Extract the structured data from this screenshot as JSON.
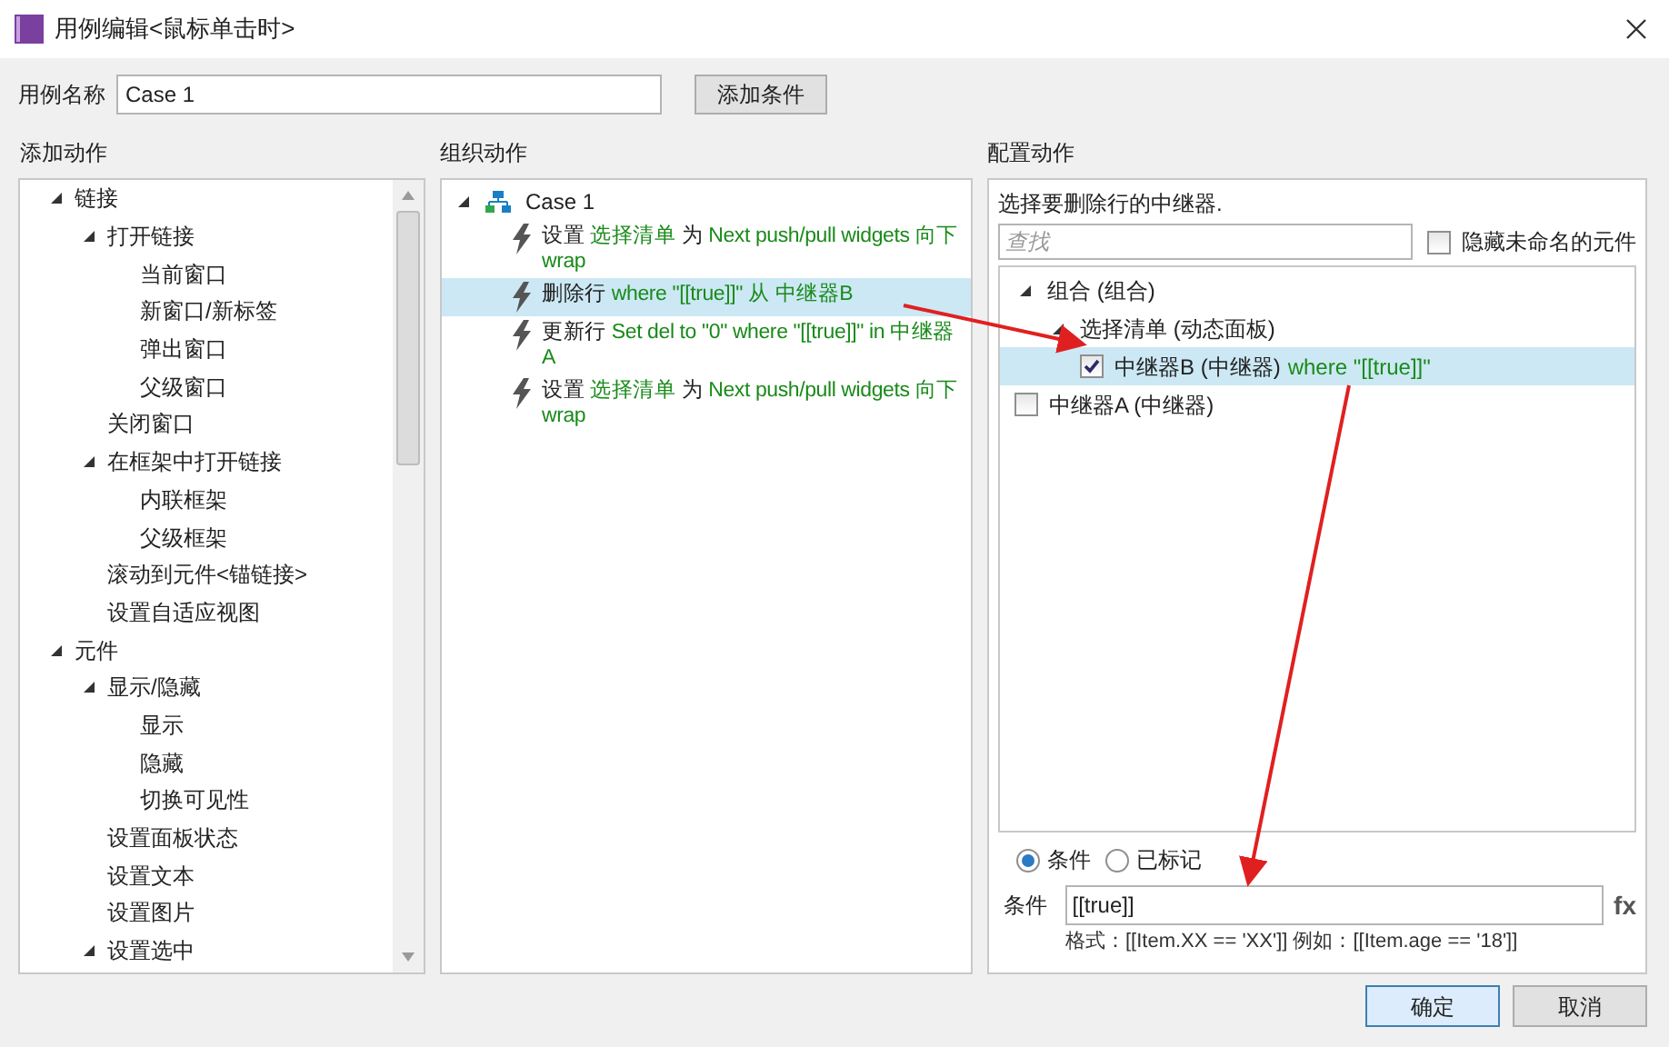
{
  "window": {
    "title": "用例编辑<鼠标单击时>"
  },
  "case_name": {
    "label": "用例名称",
    "value": "Case 1"
  },
  "add_condition_button": "添加条件",
  "add_actions": {
    "title": "添加动作",
    "tree": [
      {
        "label": "链接",
        "expanded": true,
        "children": [
          {
            "label": "打开链接",
            "expanded": true,
            "children": [
              {
                "label": "当前窗口"
              },
              {
                "label": "新窗口/新标签"
              },
              {
                "label": "弹出窗口"
              },
              {
                "label": "父级窗口"
              }
            ]
          },
          {
            "label": "关闭窗口"
          },
          {
            "label": "在框架中打开链接",
            "expanded": true,
            "children": [
              {
                "label": "内联框架"
              },
              {
                "label": "父级框架"
              }
            ]
          },
          {
            "label": "滚动到元件<锚链接>"
          },
          {
            "label": "设置自适应视图"
          }
        ]
      },
      {
        "label": "元件",
        "expanded": true,
        "children": [
          {
            "label": "显示/隐藏",
            "expanded": true,
            "children": [
              {
                "label": "显示"
              },
              {
                "label": "隐藏"
              },
              {
                "label": "切换可见性"
              }
            ]
          },
          {
            "label": "设置面板状态"
          },
          {
            "label": "设置文本"
          },
          {
            "label": "设置图片"
          },
          {
            "label": "设置选中",
            "expanded": true
          }
        ]
      }
    ]
  },
  "organize_actions": {
    "title": "组织动作",
    "case": {
      "label": "Case 1",
      "expanded": true
    },
    "actions": [
      {
        "selected": false,
        "parts": [
          {
            "text": "设置",
            "kind": "plain"
          },
          {
            "text": "选择清单",
            "kind": "highlight"
          },
          {
            "text": "为",
            "kind": "plain"
          },
          {
            "text": "Next push/pull widgets 向下 wrap",
            "kind": "highlight"
          }
        ]
      },
      {
        "selected": true,
        "parts": [
          {
            "text": "删除行",
            "kind": "plain"
          },
          {
            "text": "where \"[[true]]\" 从 中继器B",
            "kind": "highlight"
          }
        ]
      },
      {
        "selected": false,
        "parts": [
          {
            "text": "更新行",
            "kind": "plain"
          },
          {
            "text": "Set del to \"0\" where \"[[true]]\" in 中继器A",
            "kind": "highlight"
          }
        ]
      },
      {
        "selected": false,
        "parts": [
          {
            "text": "设置",
            "kind": "plain"
          },
          {
            "text": "选择清单",
            "kind": "highlight"
          },
          {
            "text": "为",
            "kind": "plain"
          },
          {
            "text": "Next push/pull widgets 向下 wrap",
            "kind": "highlight"
          }
        ]
      }
    ]
  },
  "configure": {
    "title": "配置动作",
    "instruction": "选择要删除行的中继器.",
    "search": {
      "placeholder": "查找"
    },
    "hide_unnamed": {
      "label": "隐藏未命名的元件",
      "checked": false
    },
    "tree": [
      {
        "label": "组合 (组合)",
        "expanded": true,
        "children": [
          {
            "label": "选择清单 (动态面板)",
            "expanded": true,
            "children": [
              {
                "label": "中继器B (中继器)",
                "suffix": "where \"[[true]]\"",
                "checked": true,
                "selected": true
              }
            ]
          }
        ]
      },
      {
        "label": "中继器A (中继器)",
        "checked": false,
        "selected": false
      }
    ],
    "modes": [
      {
        "label": "条件",
        "selected": true
      },
      {
        "label": "已标记",
        "selected": false
      }
    ],
    "condition": {
      "label": "条件",
      "value": "[[true]]",
      "fx": "fx",
      "hint": "格式：[[Item.XX == 'XX']] 例如：[[Item.age == '18']]"
    }
  },
  "buttons": [
    {
      "label": "确定",
      "kind": "primary"
    },
    {
      "label": "取消",
      "kind": "secondary"
    }
  ]
}
